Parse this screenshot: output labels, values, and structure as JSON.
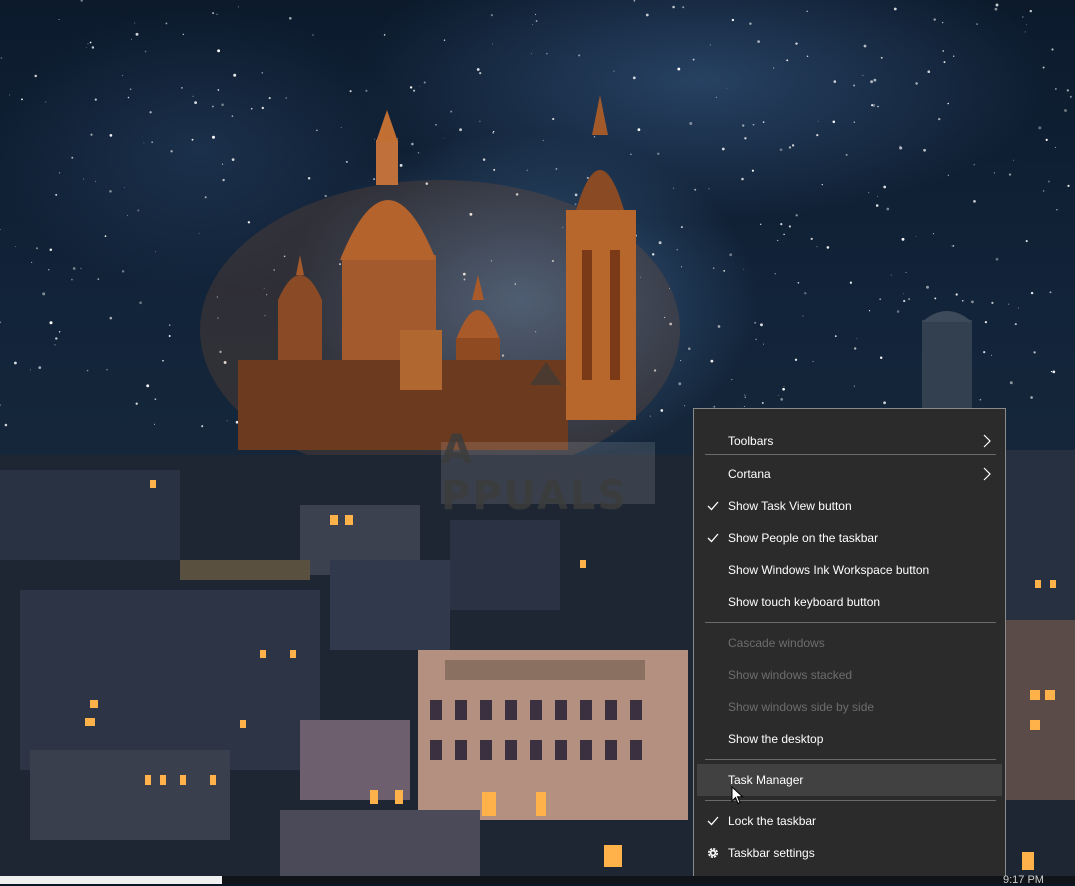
{
  "watermark": {
    "text": "A PPUALS"
  },
  "context_menu": {
    "items": [
      {
        "label": "Toolbars",
        "checked": false,
        "submenu": true,
        "disabled": false
      },
      {
        "label": "Cortana",
        "checked": false,
        "submenu": true,
        "disabled": false
      },
      {
        "label": "Show Task View button",
        "checked": true,
        "submenu": false,
        "disabled": false
      },
      {
        "label": "Show People on the taskbar",
        "checked": true,
        "submenu": false,
        "disabled": false
      },
      {
        "label": "Show Windows Ink Workspace button",
        "checked": false,
        "submenu": false,
        "disabled": false
      },
      {
        "label": "Show touch keyboard button",
        "checked": false,
        "submenu": false,
        "disabled": false
      },
      {
        "label": "Cascade windows",
        "checked": false,
        "submenu": false,
        "disabled": true
      },
      {
        "label": "Show windows stacked",
        "checked": false,
        "submenu": false,
        "disabled": true
      },
      {
        "label": "Show windows side by side",
        "checked": false,
        "submenu": false,
        "disabled": true
      },
      {
        "label": "Show the desktop",
        "checked": false,
        "submenu": false,
        "disabled": false
      },
      {
        "label": "Task Manager",
        "checked": false,
        "submenu": false,
        "disabled": false,
        "highlighted": true
      },
      {
        "label": "Lock the taskbar",
        "checked": true,
        "submenu": false,
        "disabled": false
      },
      {
        "label": "Taskbar settings",
        "checked": false,
        "submenu": false,
        "disabled": false,
        "icon": "gear-icon"
      }
    ]
  },
  "taskbar": {
    "clock": "9:17 PM"
  },
  "colors": {
    "menu_background": "#2b2b2b",
    "menu_border": "#8a8a8a",
    "menu_text": "#ffffff",
    "menu_disabled_text": "#6d6d6d",
    "menu_highlight": "#414141"
  }
}
